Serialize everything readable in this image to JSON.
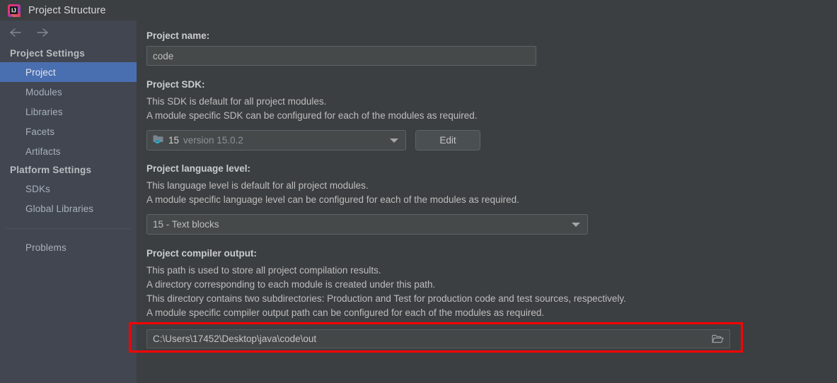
{
  "window": {
    "title": "Project Structure",
    "logo_icon": "intellij-idea-logo"
  },
  "sidebar": {
    "nav": {
      "back_icon": "arrow-left-icon",
      "forward_icon": "arrow-right-icon"
    },
    "groups": [
      {
        "header": "Project Settings",
        "items": [
          {
            "label": "Project",
            "selected": true
          },
          {
            "label": "Modules",
            "selected": false
          },
          {
            "label": "Libraries",
            "selected": false
          },
          {
            "label": "Facets",
            "selected": false
          },
          {
            "label": "Artifacts",
            "selected": false
          }
        ]
      },
      {
        "header": "Platform Settings",
        "items": [
          {
            "label": "SDKs",
            "selected": false
          },
          {
            "label": "Global Libraries",
            "selected": false
          }
        ]
      }
    ],
    "problems_label": "Problems"
  },
  "main": {
    "project_name": {
      "label": "Project name:",
      "value": "code"
    },
    "project_sdk": {
      "label": "Project SDK:",
      "desc_line1": "This SDK is default for all project modules.",
      "desc_line2": "A module specific SDK can be configured for each of the modules as required.",
      "sdk_icon": "java-sdk-folder-icon",
      "sdk_name": "15",
      "sdk_version": "version 15.0.2",
      "dropdown_icon": "chevron-down-icon",
      "edit_label": "Edit"
    },
    "language_level": {
      "label": "Project language level:",
      "desc_line1": "This language level is default for all project modules.",
      "desc_line2": "A module specific language level can be configured for each of the modules as required.",
      "value": "15 - Text blocks",
      "dropdown_icon": "chevron-down-icon"
    },
    "compiler_output": {
      "label": "Project compiler output:",
      "desc_line1": "This path is used to store all project compilation results.",
      "desc_line2": "A directory corresponding to each module is created under this path.",
      "desc_line3": "This directory contains two subdirectories: Production and Test for production code and test sources, respectively.",
      "desc_line4": "A module specific compiler output path can be configured for each of the modules as required.",
      "value": "C:\\Users\\17452\\Desktop\\java\\code\\out",
      "browse_icon": "folder-open-icon"
    }
  },
  "annotation": {
    "highlight_color": "#ff0000"
  },
  "colors": {
    "selection": "#4a6fb0",
    "sidebar_bg": "#414650",
    "content_bg": "#3c3f41"
  }
}
